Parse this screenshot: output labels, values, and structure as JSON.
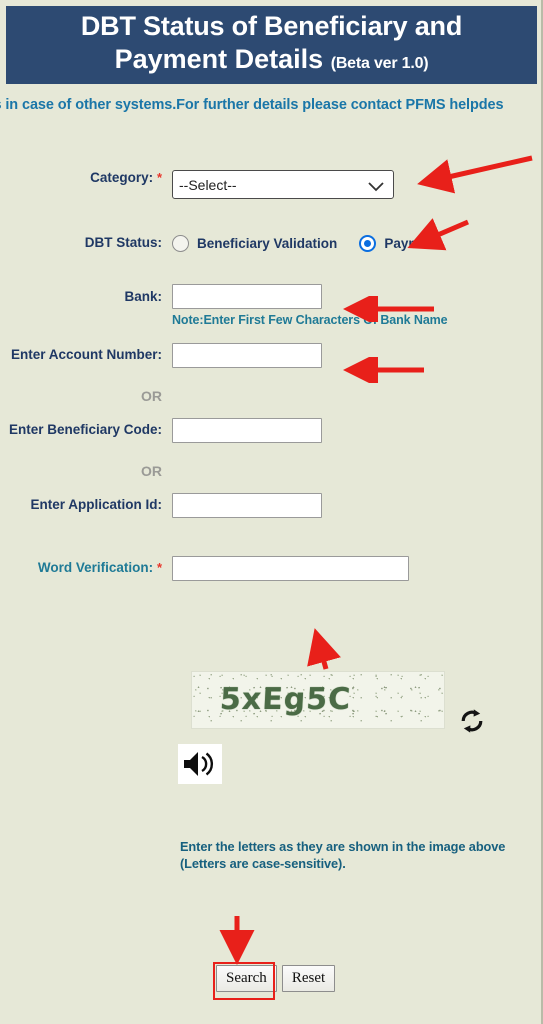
{
  "header": {
    "title_line1": "DBT Status of Beneficiary and",
    "title_line2": "Payment Details",
    "beta": "(Beta ver 1.0)"
  },
  "marquee": {
    "text": "ths in case of other systems.For further details please contact PFMS helpdes"
  },
  "form": {
    "category": {
      "label": "Category:",
      "required_mark": "*",
      "selected": "--Select--",
      "options": [
        "--Select--"
      ]
    },
    "dbt_status": {
      "label": "DBT Status:",
      "options": [
        {
          "label": "Beneficiary Validation",
          "checked": false
        },
        {
          "label": "Payment",
          "checked": true
        }
      ]
    },
    "bank": {
      "label": "Bank:",
      "value": "",
      "note": "Note:Enter First Few Characters Of Bank Name"
    },
    "account_number": {
      "label": "Enter Account Number:",
      "value": ""
    },
    "or_1": "OR",
    "beneficiary_code": {
      "label": "Enter Beneficiary Code:",
      "value": ""
    },
    "or_2": "OR",
    "application_id": {
      "label": "Enter Application Id:",
      "value": ""
    },
    "word_verification": {
      "label": "Word Verification:",
      "required_mark": "*",
      "value": ""
    }
  },
  "captcha": {
    "text": "5xEg5C",
    "refresh_icon": "refresh-icon",
    "audio_icon": "speaker-icon"
  },
  "instructions": {
    "line1": "Enter the letters as they are shown in the image above",
    "line2": "(Letters are case-sensitive)."
  },
  "buttons": {
    "search": "Search",
    "reset": "Reset"
  },
  "colors": {
    "header_bg": "#2d4a72",
    "page_bg": "#e6e8d7",
    "label": "#1f3864",
    "teal_label": "#1f7a96",
    "marquee": "#1a76a8",
    "required": "#e8342a",
    "radio_selected": "#0b6ee0",
    "annotation": "#e8201a",
    "or_text": "#9a9a96"
  }
}
